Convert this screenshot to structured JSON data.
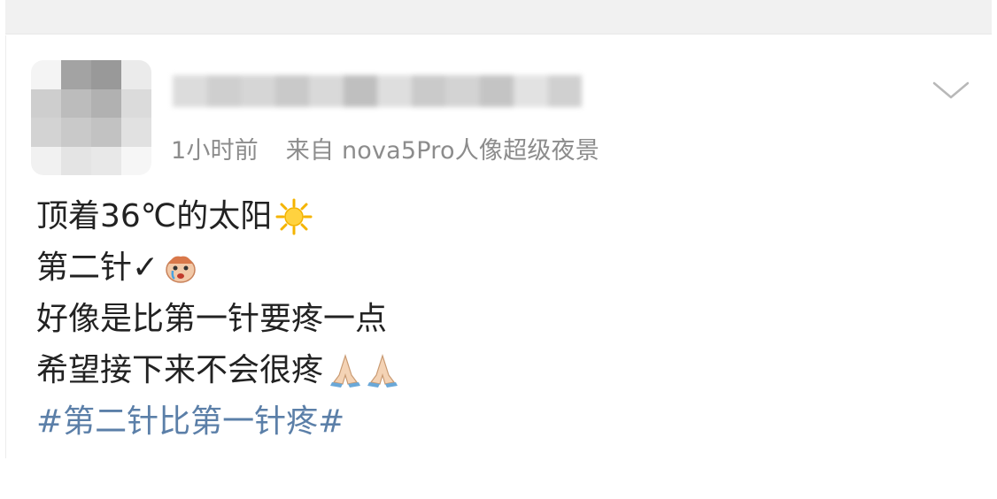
{
  "post": {
    "meta_time": "1小时前",
    "meta_source": "来自 nova5Pro人像超级夜景",
    "lines": [
      "顶着36℃的太阳",
      "第二针✓",
      "好像是比第一针要疼一点",
      "希望接下来不会很疼",
      "#第二针比第一针疼#"
    ],
    "emojis": [
      "sun-emoji",
      "crying-face-emoji",
      "praying-hands-emoji",
      "praying-hands-emoji"
    ]
  },
  "colors": {
    "text": "#222222",
    "meta": "#8c8c8c",
    "hashtag": "#5b7fa8",
    "top_strip": "#f1f1f1"
  }
}
